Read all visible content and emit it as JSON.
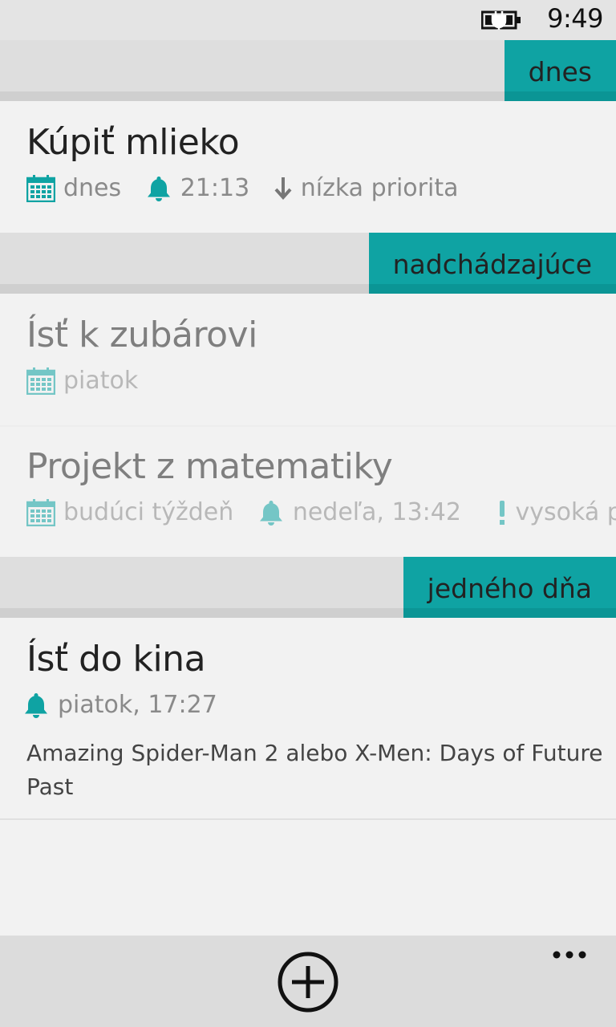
{
  "status_bar": {
    "time": "9:49",
    "battery_icon": "battery-charging-icon"
  },
  "sections": {
    "today": {
      "label": "dnes"
    },
    "upcoming": {
      "label": "nadchádzajúce"
    },
    "someday": {
      "label": "jedného dňa"
    }
  },
  "tasks": {
    "buy_milk": {
      "title": "Kúpiť mlieko",
      "date": "dnes",
      "reminder": "21:13",
      "priority": "nízka priorita",
      "priority_icon": "arrow-down-icon"
    },
    "dentist": {
      "title": "Ísť k zubárovi",
      "date": "piatok"
    },
    "math_project": {
      "title": "Projekt z matematiky",
      "date": "budúci týždeň",
      "reminder": "nedeľa, 13:42",
      "priority": "vysoká priorita",
      "priority_icon": "exclamation-icon"
    },
    "cinema": {
      "title": "Ísť do kina",
      "reminder": "piatok, 17:27",
      "note": "Amazing Spider-Man 2 alebo X-Men: Days of Future Past"
    }
  },
  "app_bar": {
    "add_icon": "add-circle-icon",
    "more_icon": "more-dots-icon"
  },
  "colors": {
    "accent": "#0fa3a3",
    "background": "#f2f2f2",
    "header": "#dedede",
    "muted_text": "#8a8a8a"
  }
}
